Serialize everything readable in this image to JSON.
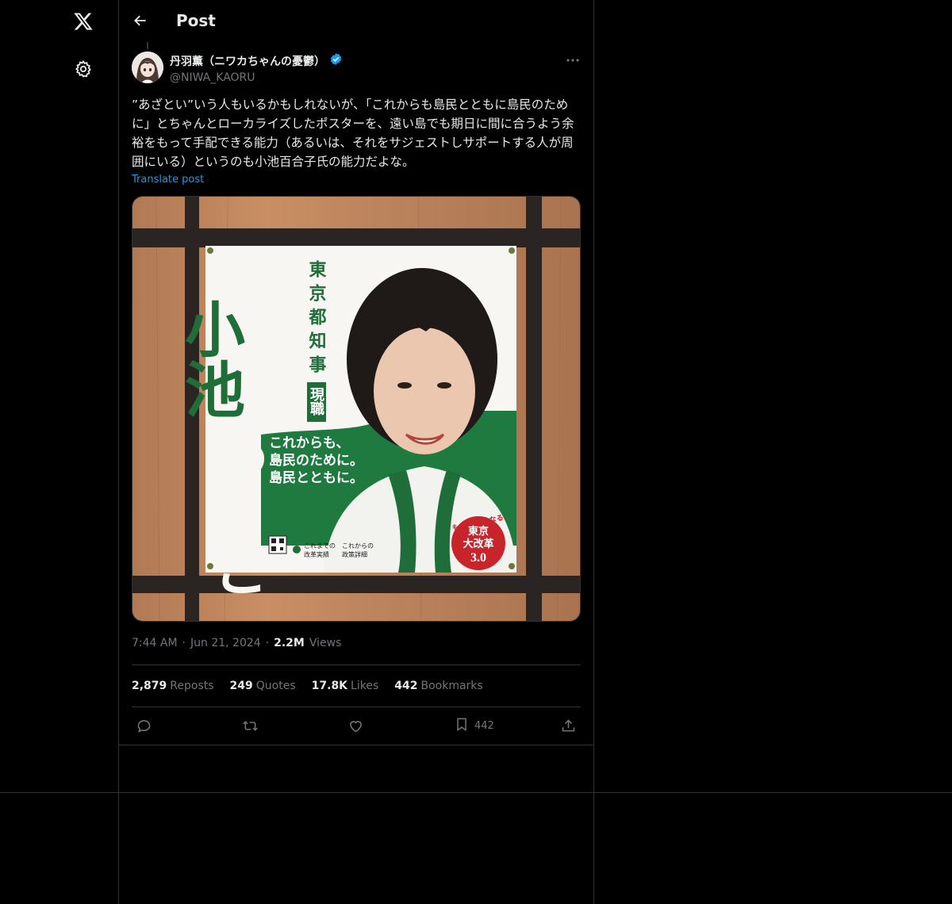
{
  "header": {
    "title": "Post"
  },
  "nav": {
    "logo_icon": "x-logo-icon",
    "settings_icon": "gear-icon"
  },
  "post": {
    "author_name": "丹羽薫（ニワカちゃんの憂鬱）",
    "verified": true,
    "handle": "@NIWA_KAORU",
    "text": "”あざとい”いう人もいるかもしれないが、「これからも島民とともに島民のために」とちゃんとローカライズしたポスターを、遠い島でも期日に間に合うよう余裕をもって手配できる能力（あるいは、それをサジェストしサポートする人が周囲にいる）というのも小池百合子氏の能力だよな。",
    "translate_label": "Translate post",
    "time": "7:44 AM",
    "date": "Jun 21, 2024",
    "views_count": "2.2M",
    "views_label": "Views",
    "image": {
      "name_big": "小池",
      "name_kana": "ゆりこ",
      "title_vertical": "東京都知事",
      "badge": "現職",
      "slogan": [
        "これからも、",
        "島民のために。",
        "島民とともに。"
      ],
      "emblem_top": "もっと!よくなる!",
      "emblem_lines": [
        "東京",
        "大改革",
        "3.0"
      ],
      "bottom_left": [
        "これまでの",
        "改革実績"
      ],
      "bottom_right": [
        "これからの",
        "政策詳細"
      ]
    }
  },
  "stats": {
    "reposts_count": "2,879",
    "reposts_label": "Reposts",
    "quotes_count": "249",
    "quotes_label": "Quotes",
    "likes_count": "17.8K",
    "likes_label": "Likes",
    "bookmarks_count": "442",
    "bookmarks_label": "Bookmarks"
  },
  "actions": {
    "bookmark_count": "442"
  },
  "colors": {
    "accent": "#1d9bf0",
    "poster_green": "#1f7a3f",
    "emblem_red": "#c8242b"
  }
}
